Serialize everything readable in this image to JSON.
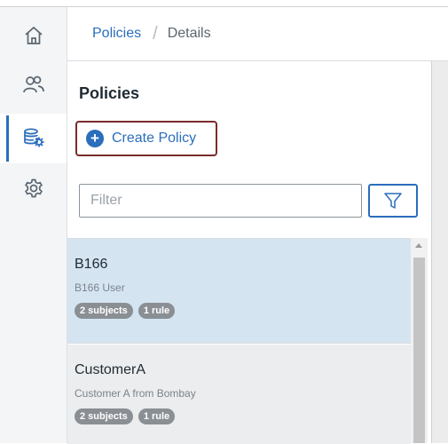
{
  "breadcrumb": {
    "root": "Policies",
    "separator": "/",
    "current": "Details"
  },
  "nav": [
    {
      "name": "home-icon"
    },
    {
      "name": "users-icon"
    },
    {
      "name": "policies-icon",
      "active": true
    },
    {
      "name": "settings-icon"
    }
  ],
  "panel": {
    "title": "Policies",
    "create_label": "Create Policy",
    "filter_placeholder": "Filter",
    "filter_value": ""
  },
  "policies": [
    {
      "name": "B166",
      "description": "B166 User",
      "subjects": "2 subjects",
      "rules": "1 rule",
      "selected": true
    },
    {
      "name": "CustomerA",
      "description": "Customer A from Bombay",
      "subjects": "2 subjects",
      "rules": "1 rule",
      "selected": false
    }
  ],
  "colors": {
    "accent": "#2a6ebc",
    "selected_row": "#d5e4f1",
    "focus_outline": "#7b2b2b",
    "tag": "#8a8f94"
  }
}
